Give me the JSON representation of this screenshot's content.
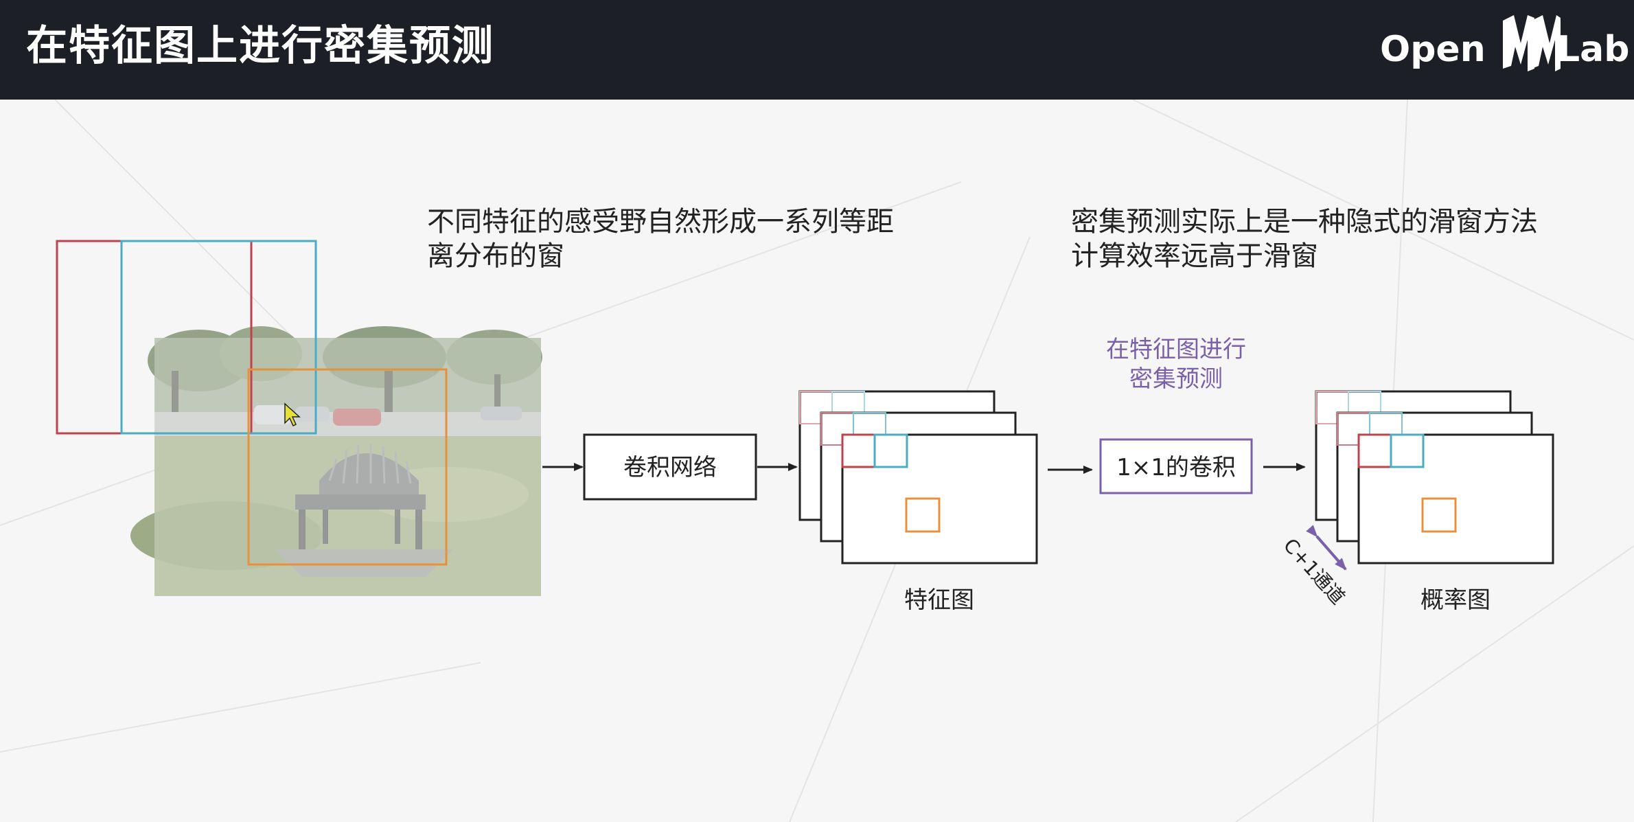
{
  "slide": {
    "title": "在特征图上进行密集预测",
    "logo": {
      "open": "Open",
      "lab": "Lab"
    },
    "text_left_line1": "不同特征的感受野自然形成一系列等距",
    "text_left_line2": "离分布的窗",
    "text_right_line1": "密集预测实际上是一种隐式的滑窗方法",
    "text_right_line2": "计算效率远高于滑窗",
    "conv_network_label": "卷积网络",
    "feature_map_label": "特征图",
    "dense_predict_line1": "在特征图进行",
    "dense_predict_line2": "密集预测",
    "conv1x1_label": "1×1的卷积",
    "prob_map_label": "概率图",
    "channels_label": "C+1通道"
  },
  "colors": {
    "header_bg": "#1d1f26",
    "red": "#c0434c",
    "cyan": "#4aabc4",
    "orange": "#e8913c",
    "purple": "#7a60a8"
  },
  "icons": [
    "openmmlab-logo",
    "arrow-right-icon",
    "cursor-icon",
    "double-arrow-icon"
  ]
}
